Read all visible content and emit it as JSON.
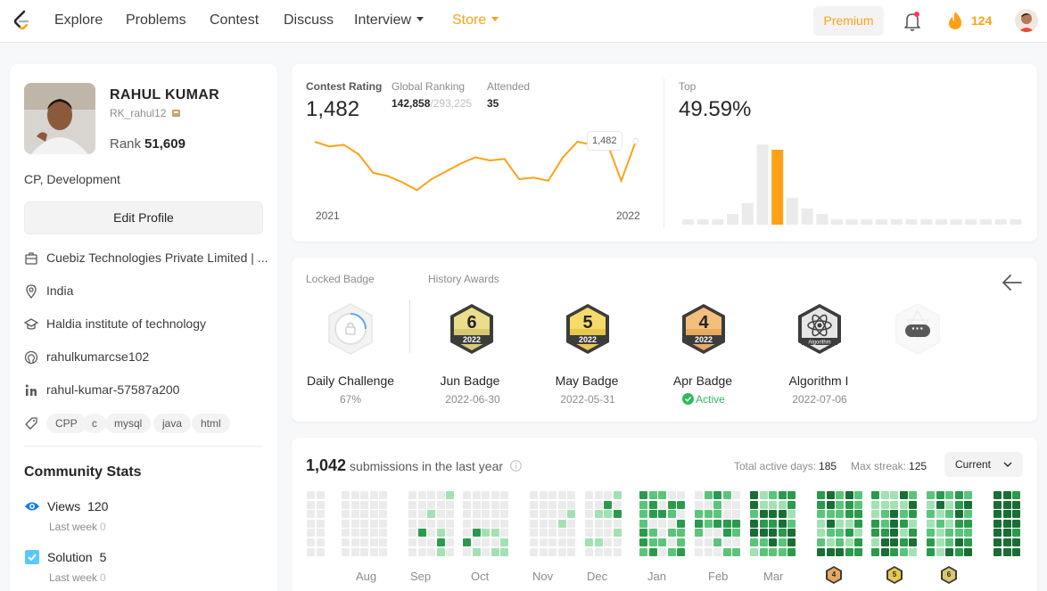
{
  "nav": {
    "items": [
      "Explore",
      "Problems",
      "Contest",
      "Discuss",
      "Interview",
      "Store"
    ],
    "premium": "Premium",
    "streak": "124",
    "colors": {
      "accent": "#ffa116"
    }
  },
  "profile": {
    "name": "RAHUL KUMAR",
    "username": "RK_rahul12",
    "rank_label": "Rank",
    "rank_value": "51,609",
    "bio": "CP, Development",
    "edit_label": "Edit Profile",
    "company": "Cuebiz Technologies Private Limited | ...",
    "location": "India",
    "school": "Haldia institute of technology",
    "github": "rahulkumarcse102",
    "linkedin": "rahul-kumar-57587a200",
    "skills": [
      "CPP",
      "c",
      "mysql",
      "java",
      "html"
    ],
    "icons": [
      "building-icon",
      "location-pin-icon",
      "graduation-cap-icon",
      "github-icon",
      "linkedin-icon",
      "tag-icon"
    ]
  },
  "community": {
    "title": "Community Stats",
    "stats": [
      {
        "label": "Views",
        "value": "120",
        "sub_label": "Last week",
        "sub_value": "0"
      },
      {
        "label": "Solution",
        "value": "5",
        "sub_label": "Last week",
        "sub_value": "0"
      }
    ]
  },
  "contest": {
    "rating_label": "Contest Rating",
    "rating": "1,482",
    "global_label": "Global Ranking",
    "global_rank": "142,858",
    "global_total": "/293,225",
    "attended_label": "Attended",
    "attended": "35",
    "top_label": "Top",
    "top_value": "49.59%",
    "tooltip": "1,482",
    "year_start": "2021",
    "year_end": "2022",
    "line_color": "#ffa116",
    "histogram_highlight_color": "#ffa116",
    "histogram_color": "#ebebeb"
  },
  "chart_data": [
    {
      "type": "line",
      "title": "Contest Rating",
      "x": [
        "2021",
        "",
        "",
        "",
        "",
        "",
        "",
        "",
        "",
        "",
        "",
        "",
        "",
        "",
        "",
        "",
        "",
        "",
        "",
        "",
        "",
        "",
        "2022"
      ],
      "y": [
        1480,
        1465,
        1470,
        1440,
        1380,
        1370,
        1350,
        1325,
        1360,
        1385,
        1410,
        1430,
        1420,
        1425,
        1360,
        1365,
        1355,
        1430,
        1480,
        1470,
        1480,
        1355,
        1482
      ],
      "ylabel": "",
      "xlabel": ""
    },
    {
      "type": "bar",
      "title": "Top 49.59%",
      "values": [
        1,
        1,
        1,
        2,
        4,
        15,
        14,
        5,
        3,
        2,
        1,
        1,
        1,
        1,
        1,
        1,
        1,
        1,
        1,
        1,
        1,
        1,
        1
      ],
      "highlight_index": 6
    }
  ],
  "badges": {
    "locked_label": "Locked Badge",
    "history_label": "History Awards",
    "locked": {
      "name": "Daily Challenge",
      "sub": "67%"
    },
    "awards": [
      {
        "name": "Jun Badge",
        "date": "2022-06-30",
        "number": "6",
        "year": "2022"
      },
      {
        "name": "May Badge",
        "date": "2022-05-31",
        "number": "5",
        "year": "2022"
      },
      {
        "name": "Apr Badge",
        "date": "Active",
        "number": "4",
        "year": "2022"
      },
      {
        "name": "Algorithm I",
        "date": "2022-07-06",
        "number": "",
        "year": "Algorithm"
      }
    ]
  },
  "submissions": {
    "count": "1,042",
    "label": "submissions in the last year",
    "active_label": "Total active days:",
    "active_days": "185",
    "streak_label": "Max streak:",
    "max_streak": "125",
    "filter": "Current",
    "months": [
      "Aug",
      "Sep",
      "Oct",
      "Nov",
      "Dec",
      "Jan",
      "Feb",
      "Mar"
    ],
    "legend_badges": [
      "4",
      "5",
      "6"
    ]
  }
}
